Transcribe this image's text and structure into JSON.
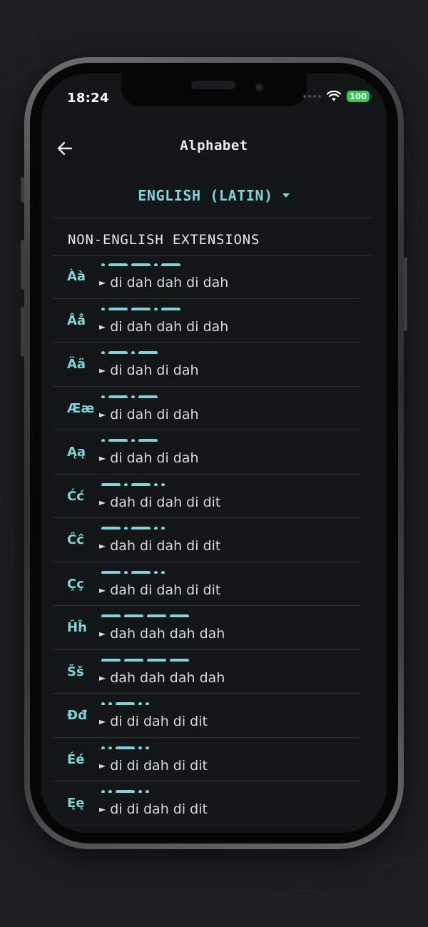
{
  "status_bar": {
    "time": "18:24",
    "battery": "100"
  },
  "header": {
    "title": "Alphabet",
    "back_icon": "arrow-left-icon"
  },
  "language_selector": {
    "label": "ENGLISH (LATIN)",
    "icon": "caret-down-icon"
  },
  "section": {
    "title": "NON-ENGLISH EXTENSIONS"
  },
  "colors": {
    "accent": "#7fd3da",
    "background": "#121616",
    "text": "#d6dada",
    "battery": "#34c759"
  },
  "letters": [
    {
      "glyph": "Àà",
      "code": ".--.-",
      "phonetic": "di dah dah di dah"
    },
    {
      "glyph": "Åå",
      "code": ".--.-",
      "phonetic": "di dah dah di dah"
    },
    {
      "glyph": "Ää",
      "code": ".-.-",
      "phonetic": "di dah di dah"
    },
    {
      "glyph": "Ææ",
      "code": ".-.-",
      "phonetic": "di dah di dah"
    },
    {
      "glyph": "Ąą",
      "code": ".-.-",
      "phonetic": "di dah di dah"
    },
    {
      "glyph": "Ćć",
      "code": "-.-..",
      "phonetic": "dah di dah di dit"
    },
    {
      "glyph": "Ĉĉ",
      "code": "-.-..",
      "phonetic": "dah di dah di dit"
    },
    {
      "glyph": "Çç",
      "code": "-.-..",
      "phonetic": "dah di dah di dit"
    },
    {
      "glyph": "Ĥĥ",
      "code": "----",
      "phonetic": "dah dah dah dah"
    },
    {
      "glyph": "Šš",
      "code": "----",
      "phonetic": "dah dah dah dah"
    },
    {
      "glyph": "Đđ",
      "code": "..-..",
      "phonetic": "di di dah di dit"
    },
    {
      "glyph": "Éé",
      "code": "..-..",
      "phonetic": "di di dah di dit"
    },
    {
      "glyph": "Ęę",
      "code": "..-..",
      "phonetic": "di di dah di dit"
    }
  ]
}
